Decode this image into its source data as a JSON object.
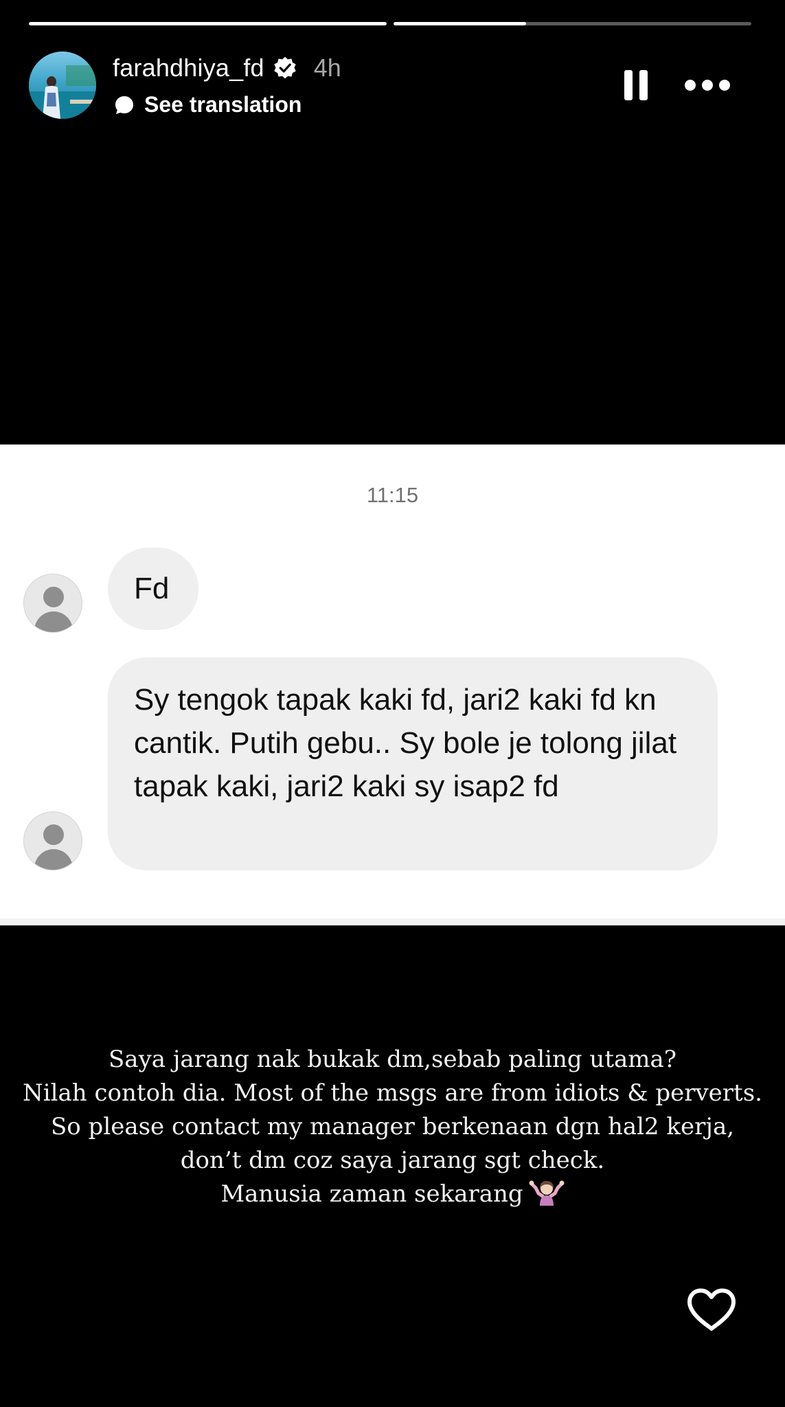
{
  "story": {
    "progress": [
      1.0,
      0.37
    ]
  },
  "header": {
    "username": "farahdhiya_fd",
    "time_ago": "4h",
    "translation_label": "See translation"
  },
  "icons": {
    "avatar": "profile-photo",
    "verified": "verified-badge-icon",
    "translate": "speech-bubble-icon",
    "pause": "pause-icon",
    "more": "more-options-icon",
    "like": "heart-icon"
  },
  "dm_screenshot": {
    "time": "11:15",
    "messages": [
      {
        "text": "Fd"
      },
      {
        "text": "Sy tengok tapak kaki fd, jari2 kaki fd kn cantik. Putih gebu.. Sy bole je tolong jilat tapak kaki, jari2 kaki sy isap2 fd"
      }
    ]
  },
  "caption": {
    "lines": [
      "Saya jarang nak bukak dm,sebab paling utama?",
      "Nilah contoh dia. Most of the msgs are from idiots & perverts.",
      "So please contact my manager berkenaan dgn hal2 kerja,",
      "don’t dm coz saya jarang sgt check.",
      "Manusia zaman sekarang"
    ],
    "emoji": "person-shrugging-emoji"
  },
  "colors": {
    "background": "#000000",
    "bubble": "#efefef",
    "secondary_text": "#a8a8a8"
  }
}
